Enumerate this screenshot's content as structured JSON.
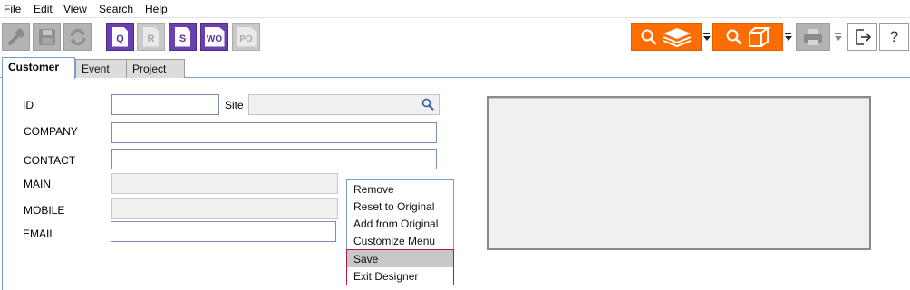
{
  "menubar": {
    "items": [
      {
        "label": "File",
        "mnemonic": "F",
        "rest": "ile"
      },
      {
        "label": "Edit",
        "mnemonic": "E",
        "rest": "dit"
      },
      {
        "label": "View",
        "mnemonic": "V",
        "rest": "iew"
      },
      {
        "label": "Search",
        "mnemonic": "S",
        "rest": "earch"
      },
      {
        "label": "Help",
        "mnemonic": "H",
        "rest": "elp"
      }
    ]
  },
  "toolbar": {
    "tools_icon": "hammer-icon",
    "save_icon": "floppy-disk-icon",
    "refresh_icon": "refresh-icon",
    "doc_buttons": [
      {
        "letter": "Q",
        "enabled": true
      },
      {
        "letter": "R",
        "enabled": false
      },
      {
        "letter": "S",
        "enabled": true
      },
      {
        "letter": "WO",
        "enabled": true
      },
      {
        "letter": "PO",
        "enabled": false
      }
    ],
    "accent_color": "#ff6d00",
    "purple_color": "#6a3fb4",
    "help_label": "?"
  },
  "tabs": [
    {
      "label": "Customer",
      "active": true
    },
    {
      "label": "Event",
      "active": false
    },
    {
      "label": "Project",
      "active": false
    }
  ],
  "form": {
    "id_label": "ID",
    "id_value": "",
    "site_label": "Site",
    "site_value": "",
    "company_label": "COMPANY",
    "company_value": "",
    "contact_label": "CONTACT",
    "contact_value": "",
    "main_label": "MAIN",
    "main_value": "",
    "mobile_label": "MOBILE",
    "mobile_value": "",
    "email_label": "EMAIL",
    "email_value": ""
  },
  "context_menu": {
    "items": [
      {
        "label": "Remove"
      },
      {
        "label": "Reset to Original"
      },
      {
        "label": "Add from Original"
      },
      {
        "label": "Customize Menu"
      }
    ],
    "highlighted_items": [
      {
        "label": "Save",
        "selected": true
      },
      {
        "label": "Exit Designer",
        "selected": false
      }
    ],
    "highlight_border_color": "#b5174a"
  }
}
